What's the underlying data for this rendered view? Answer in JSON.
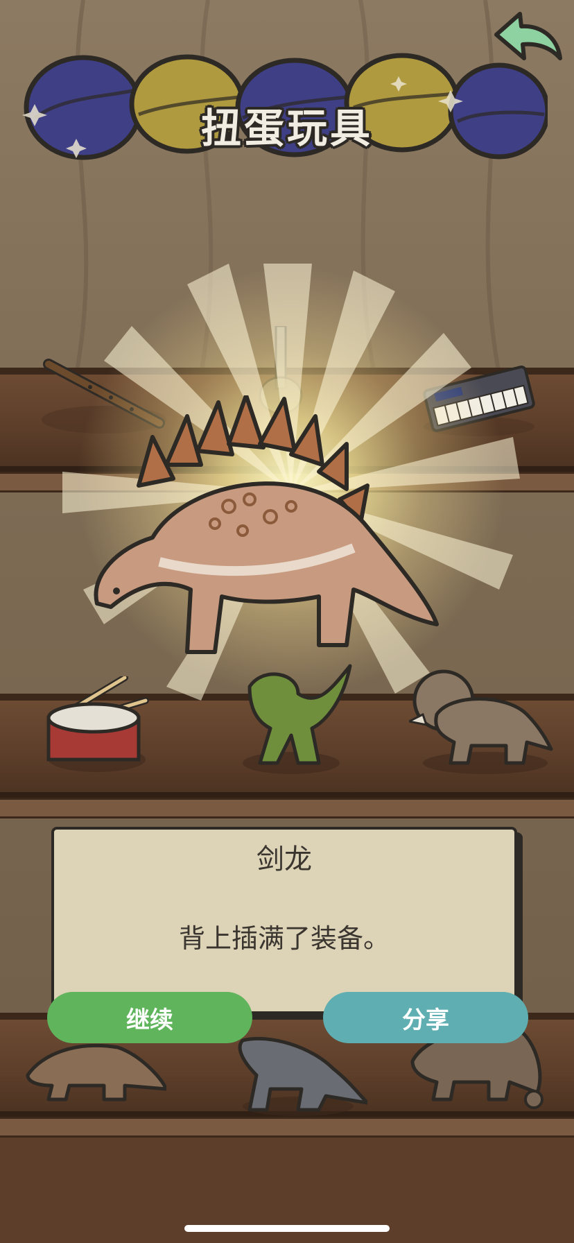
{
  "header": {
    "title": "扭蛋玩具",
    "back_icon": "back-arrow-icon"
  },
  "colors": {
    "capsule_blue": "#3f3f86",
    "capsule_yellow": "#b09a3f",
    "continue_green": "#5fb45c",
    "share_teal": "#5fafb2",
    "panel_bg": "#ddd3b7",
    "outline": "#2d2925"
  },
  "reveal": {
    "item_icon": "stegosaurus-icon",
    "item_name": "剑龙",
    "item_description": "背上插满了装备。"
  },
  "shelf_items": [
    {
      "icon": "flute-icon"
    },
    {
      "icon": "guitar-icon"
    },
    {
      "icon": "keyboard-icon"
    },
    {
      "icon": "drum-icon"
    },
    {
      "icon": "t-rex-icon"
    },
    {
      "icon": "triceratops-icon"
    },
    {
      "icon": "dinosaur-icon"
    },
    {
      "icon": "dinosaur-icon"
    },
    {
      "icon": "ankylosaurus-icon"
    }
  ],
  "buttons": {
    "continue_label": "继续",
    "share_label": "分享"
  }
}
